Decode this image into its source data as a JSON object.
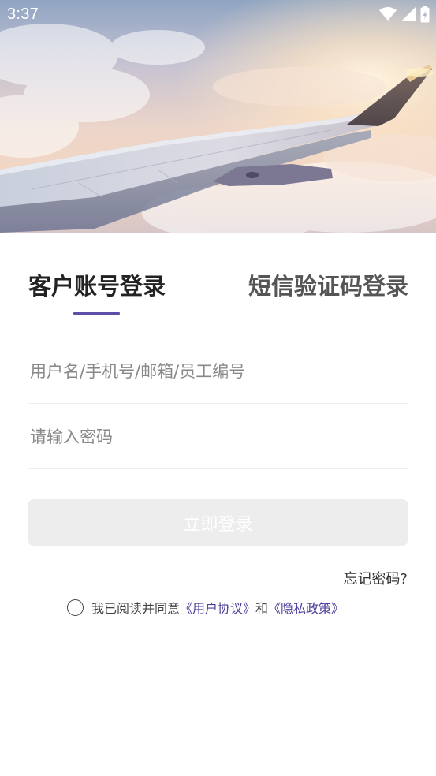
{
  "status_bar": {
    "time": "3:37",
    "icons": [
      "wifi-icon",
      "cellular-signal-icon",
      "battery-charging-icon"
    ]
  },
  "hero": {
    "image": "airplane-wing-above-clouds-photo"
  },
  "login_tabs": {
    "account_label": "客户账号登录",
    "sms_label": "短信验证码登录",
    "active": "account",
    "indicator_color": "#5b4fa8"
  },
  "form": {
    "username_placeholder": "用户名/手机号/邮箱/员工编号",
    "username_value": "",
    "password_placeholder": "请输入密码",
    "password_value": "",
    "login_button_label": "立即登录",
    "forgot_password_label": "忘记密码?"
  },
  "agreement": {
    "prefix": "我已阅读并同意",
    "user_agreement_link": "《用户协议》",
    "connector": "和",
    "privacy_policy_link": "《隐私政策》",
    "checked": false,
    "link_color": "#4b3f9a"
  }
}
